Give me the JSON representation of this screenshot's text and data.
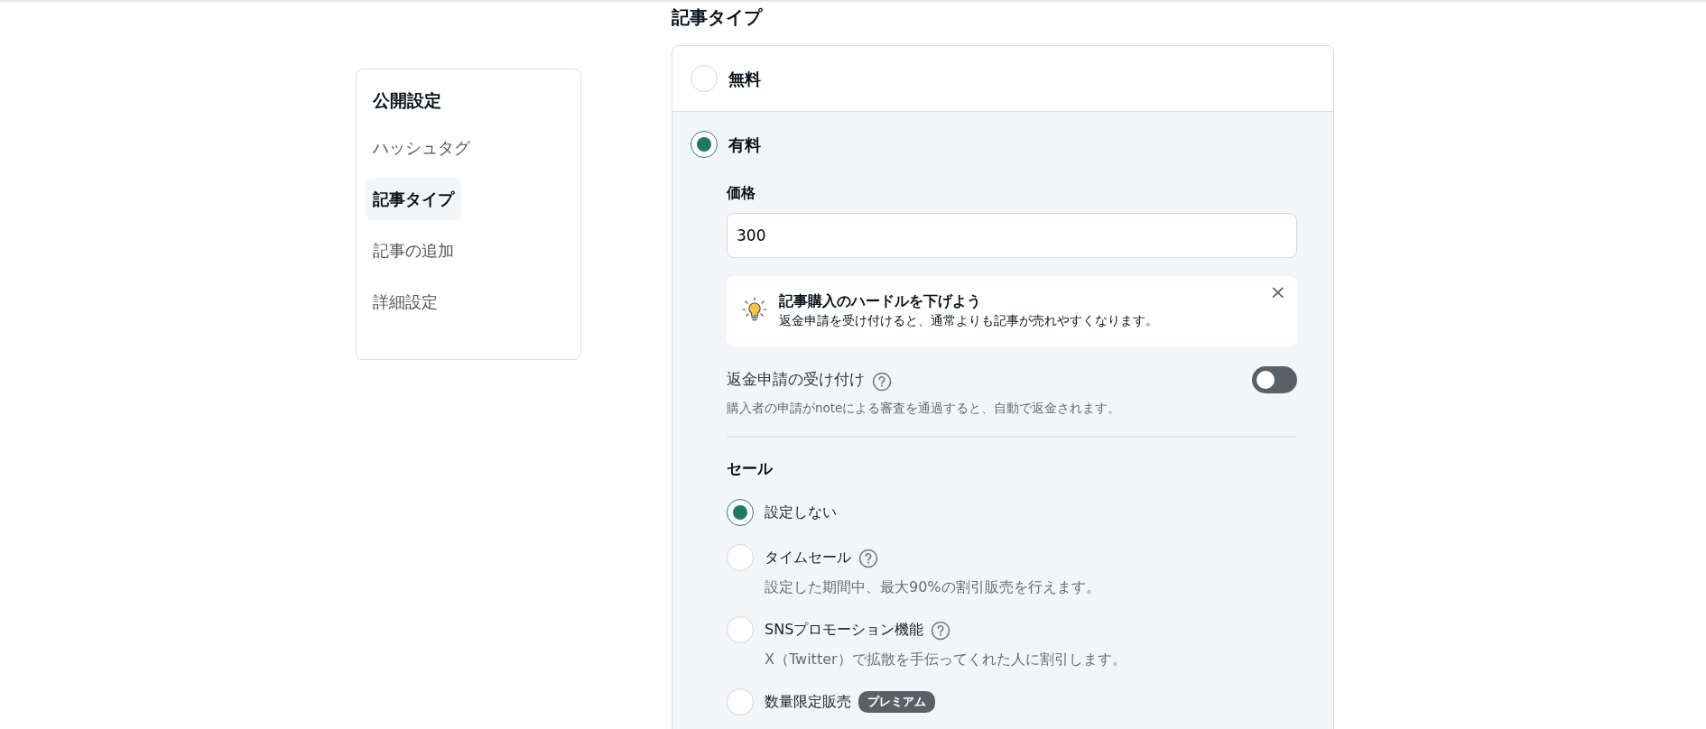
{
  "sidebar": {
    "title": "公開設定",
    "items": [
      {
        "label": "ハッシュタグ",
        "selected": false
      },
      {
        "label": "記事タイプ",
        "selected": true
      },
      {
        "label": "記事の追加",
        "selected": false
      },
      {
        "label": "詳細設定",
        "selected": false
      }
    ]
  },
  "heading": "記事タイプ",
  "types": [
    {
      "label": "無料",
      "selected": false
    },
    {
      "label": "有料",
      "selected": true
    }
  ],
  "price": {
    "label": "価格",
    "value": "300"
  },
  "tip": {
    "title": "記事購入のハードルを下げよう",
    "text": "返金申請を受け付けると、通常よりも記事が売れやすくなります。",
    "close": "×"
  },
  "refund": {
    "label": "返金申請の受け付け",
    "on": false,
    "description": "購入者の申請がnoteによる審査を通過すると、自動で返金されます。"
  },
  "sale": {
    "heading": "セール",
    "options": [
      {
        "label": "設定しない",
        "selected": true,
        "help": false
      },
      {
        "label": "タイムセール",
        "selected": false,
        "help": true,
        "description": "設定した期間中、最大90%の割引販売を行えます。"
      },
      {
        "label": "SNSプロモーション機能",
        "selected": false,
        "help": true,
        "description": "X（Twitter）で拡散を手伝ってくれた人に割引します。"
      },
      {
        "label": "数量限定販売",
        "selected": false,
        "help": false,
        "badge": "プレミアム"
      }
    ]
  }
}
